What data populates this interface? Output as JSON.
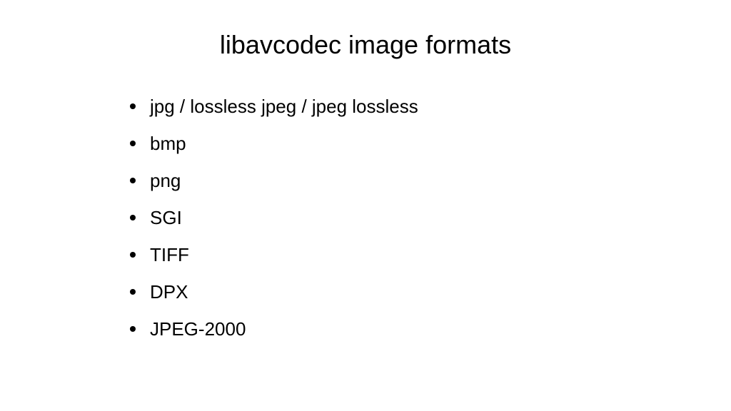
{
  "slide": {
    "title": "libavcodec image formats",
    "items": [
      "jpg / lossless jpeg / jpeg lossless",
      "bmp",
      "png",
      "SGI",
      "TIFF",
      "DPX",
      "JPEG-2000"
    ]
  }
}
